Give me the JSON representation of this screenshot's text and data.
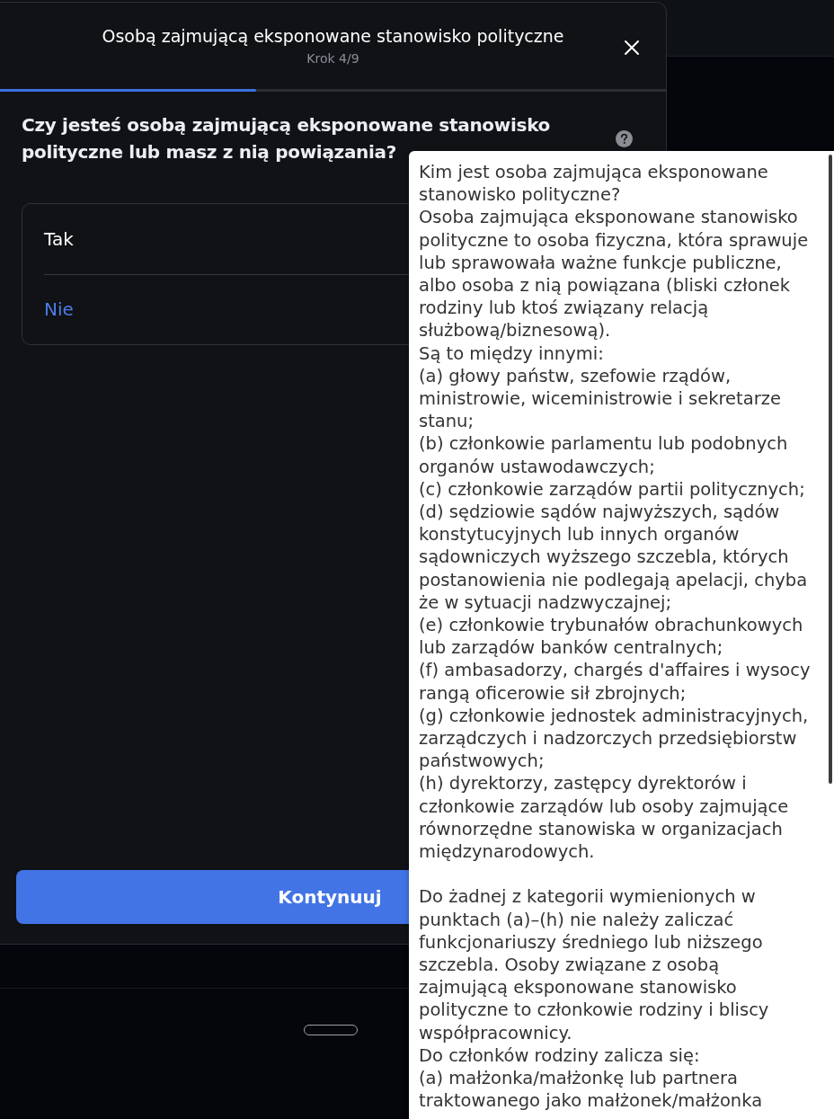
{
  "dialog": {
    "title": "Osobą zajmującą eksponowane stanowisko polityczne",
    "step": "Krok 4/9",
    "progress": {
      "level": 0.385
    }
  },
  "question": {
    "text": "Czy jesteś osobą zajmującą eksponowane stanowisko polityczne lub masz z nią powiązania?"
  },
  "options": [
    {
      "label": "Tak",
      "selected": false
    },
    {
      "label": "Nie",
      "selected": true
    }
  ],
  "continue_button": {
    "label": "Kontynuuj"
  },
  "tooltip": {
    "sections": [
      {
        "paragraphs": [
          {
            "lines": [
              "Kim jest osoba zajmująca eksponowane",
              "stanowisko polityczne?"
            ]
          },
          {
            "lines": [
              "Osoba zajmująca eksponowane stanowisko",
              "polityczne to osoba fizyczna, która sprawuje",
              "lub sprawowała ważne funkcje publiczne,",
              "albo osoba z nią powiązana (bliski członek",
              "rodziny lub ktoś związany relacją",
              "służbową/biznesową)."
            ]
          },
          {
            "lines": [
              "Są to między innymi:"
            ]
          },
          {
            "lines": [
              "(a) głowy państw, szefowie rządów,",
              "ministrowie, wiceministrowie i sekretarze",
              "stanu;"
            ]
          },
          {
            "lines": [
              "(b) członkowie parlamentu lub podobnych",
              "organów ustawodawczych;"
            ]
          },
          {
            "lines": [
              "(c) członkowie zarządów partii politycznych;"
            ]
          },
          {
            "lines": [
              "(d) sędziowie sądów najwyższych, sądów",
              "konstytucyjnych lub innych organów",
              "sądowniczych wyższego szczebla, których",
              "postanowienia nie podlegają apelacji, chyba",
              "że w sytuacji nadzwyczajnej;"
            ]
          },
          {
            "lines": [
              "(e) członkowie trybunałów obrachunkowych",
              "lub zarządów banków centralnych;"
            ]
          },
          {
            "lines": [
              "(f) ambasadorzy, chargés d'affaires i wysocy",
              "rangą oficerowie sił zbrojnych;"
            ]
          },
          {
            "lines": [
              "(g) członkowie jednostek administracyjnych,",
              "zarządczych i nadzorczych przedsiębiorstw",
              "państwowych;"
            ]
          },
          {
            "lines": [
              "(h) dyrektorzy, zastępcy dyrektorów i",
              "członkowie zarządów lub osoby zajmujące",
              "równorzędne stanowiska w organizacjach",
              "międzynarodowych."
            ]
          }
        ]
      },
      {
        "paragraphs": [
          {
            "lines": [
              "Do żadnej z kategorii wymienionych w",
              "punktach (a)–(h) nie należy zaliczać",
              "funkcjonariuszy średniego lub niższego",
              "szczebla. Osoby związane z osobą",
              "zajmującą eksponowane stanowisko",
              "polityczne to członkowie rodziny i bliscy",
              "współpracownicy."
            ]
          },
          {
            "lines": [
              "Do członków rodziny zalicza się:"
            ]
          },
          {
            "lines": [
              "(a) małżonka/małżonkę lub partnera",
              "traktowanego jako małżonek/małżonka"
            ]
          }
        ]
      }
    ]
  }
}
